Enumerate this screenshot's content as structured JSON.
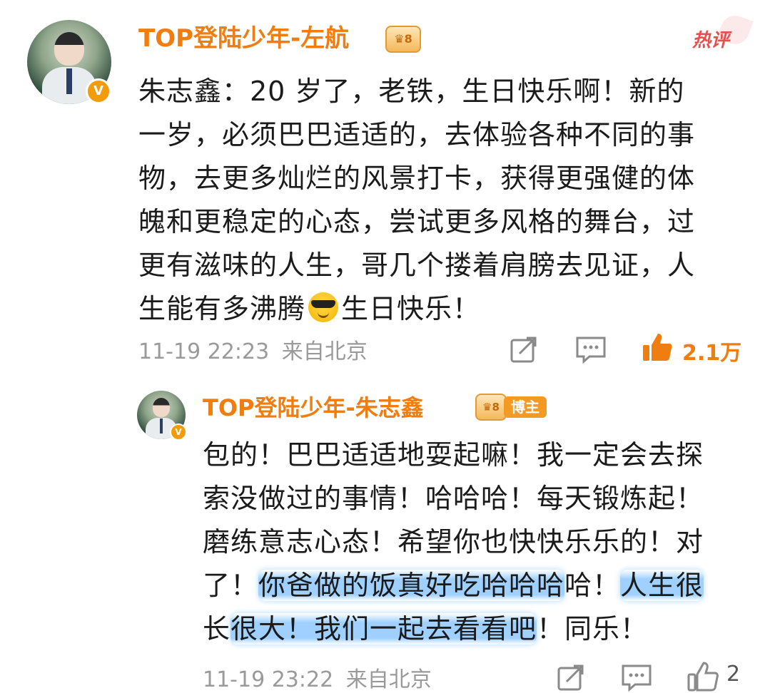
{
  "comment": {
    "author": "TOP登陆少年-左航",
    "hot_tag": "热评",
    "text": [
      "朱志鑫：20 岁了，老铁，生日快乐啊！新的",
      "一岁，必须巴巴适适的，去体验各种不同的事",
      "物，去更多灿烂的风景打卡，获得更强健的体",
      "魄和更稳定的心态，尝试更多风格的舞台，过",
      "更有滋味的人生，哥几个搂着肩膀去见证，人",
      "生能有多沸腾",
      "生日快乐！"
    ],
    "emoji": "sunglasses-face",
    "time": "11-19 22:23",
    "location": "来自北京",
    "likes": "2.1万"
  },
  "reply": {
    "author": "TOP登陆少年-朱志鑫",
    "blogger_tag": "博主",
    "text": [
      "包的！巴巴适适地耍起嘛！我一定会去探",
      "索没做过的事情！哈哈哈！每天锻炼起！",
      "磨练意志心态！希望你也快快乐乐的！对",
      "了！",
      "你爸做的饭真好吃哈哈哈",
      "哈！",
      "人生很",
      "长",
      "很大！我们一起去看看吧",
      "！同乐！"
    ],
    "time": "11-19 23:22",
    "location": "来自北京",
    "likes": "2"
  },
  "colors": {
    "accent": "#f07d10",
    "hot": "#e94e4e",
    "meta": "#9a9a9a",
    "highlight": "#50aaff"
  }
}
